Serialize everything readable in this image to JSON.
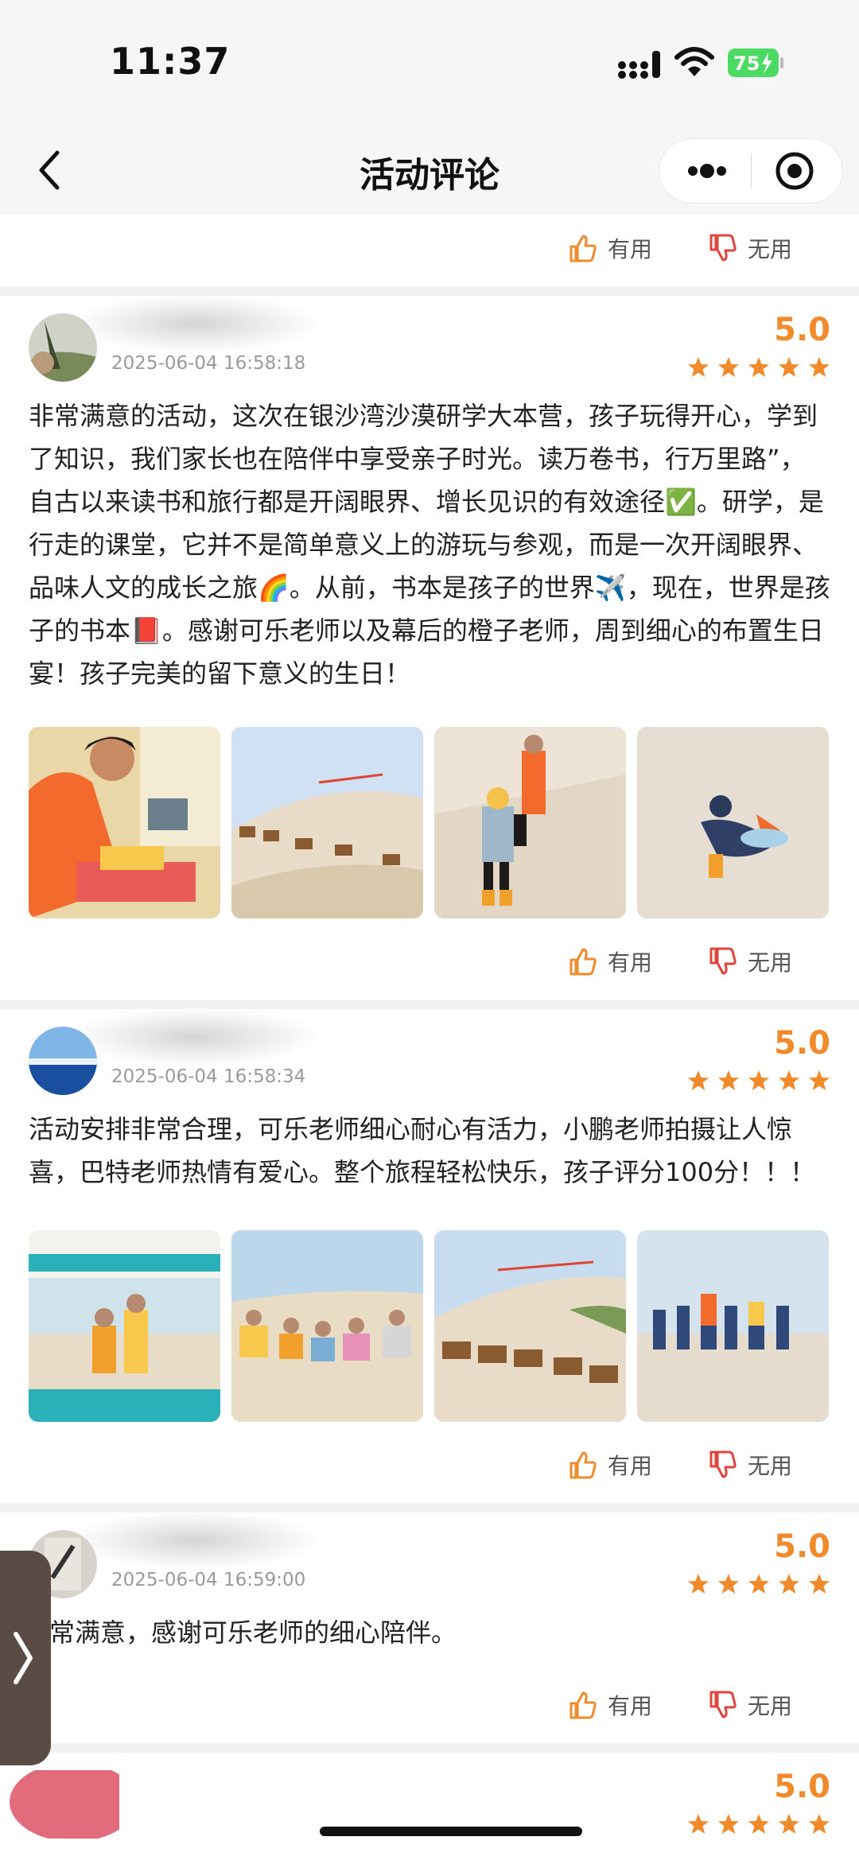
{
  "status_bar": {
    "time": "11:37",
    "battery": "75"
  },
  "nav": {
    "title": "活动评论"
  },
  "actions": {
    "useful_label": "有用",
    "useless_label": "无用"
  },
  "reviews": [
    {
      "date": "2025-06-04 16:58:18",
      "score": "5.0",
      "rating": 5,
      "text": "非常满意的活动，这次在银沙湾沙漠研学大本营，孩子玩得开心，学到了知识，我们家长也在陪伴中享受亲子时光。读万卷书，行万里路”，自古以来读书和旅行都是开阔眼界、增长见识的有效途径✅。研学，是行走的课堂，它并不是简单意义上的游玩与参观，而是一次开阔眼界、品味人文的成长之旅🌈。从前，书本是孩子的世界✈️，现在，世界是孩子的书本📕。感谢可乐老师以及幕后的橙子老师，周到细心的布置生日宴！孩子完美的留下意义的生日！"
    },
    {
      "username": "　",
      "date": "2025-06-04 16:58:34",
      "score": "5.0",
      "rating": 5,
      "text": "活动安排非常合理，可乐老师细心耐心有活力，小鹏老师拍摄让人惊喜，巴特老师热情有爱心。整个旅程轻松快乐，孩子评分100分！！！"
    },
    {
      "date": "2025-06-04 16:59:00",
      "score": "5.0",
      "rating": 5,
      "text": "常满意，感谢可乐老师的细心陪伴。"
    },
    {
      "score": "5.0",
      "rating": 5
    }
  ],
  "colors": {
    "accent": "#f08a2a",
    "separator": "#f1f1f1"
  }
}
